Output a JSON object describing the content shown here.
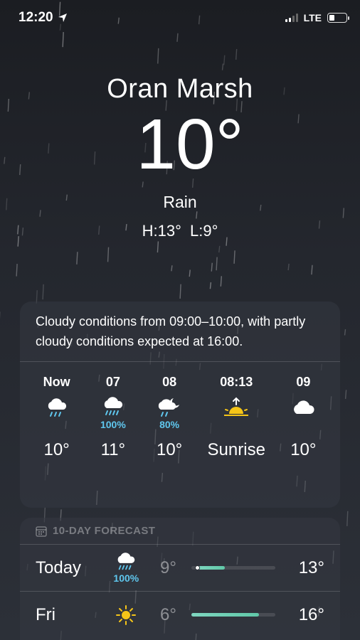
{
  "status": {
    "time": "12:20",
    "network": "LTE",
    "battery_level": 0.3,
    "signal_bars": 2
  },
  "current": {
    "city": "Oran Marsh",
    "temperature": "10°",
    "condition": "Rain",
    "high_low": "H:13°  L:9°"
  },
  "summary": "Cloudy conditions from 09:00–10:00, with partly cloudy conditions expected at 16:00.",
  "hourly": [
    {
      "time": "Now",
      "icon": "rain-cloud-icon",
      "prob": "",
      "value": "10°"
    },
    {
      "time": "07",
      "icon": "rain-cloud-icon",
      "prob": "100%",
      "value": "11°"
    },
    {
      "time": "08",
      "icon": "moon-rain-cloud-icon",
      "prob": "80%",
      "value": "10°"
    },
    {
      "time": "08:13",
      "icon": "sunrise-icon",
      "prob": "",
      "value": "Sunrise"
    },
    {
      "time": "09",
      "icon": "cloud-icon",
      "prob": "",
      "value": "10°"
    }
  ],
  "forecast": {
    "header": "10-DAY FORECAST",
    "days": [
      {
        "day": "Today",
        "icon": "rain-cloud-icon",
        "prob": "100%",
        "low": "9°",
        "high": "13°",
        "range_start": 0.05,
        "range_end": 0.4,
        "current_pos": 0.07
      },
      {
        "day": "Fri",
        "icon": "sun-icon",
        "prob": "",
        "low": "6°",
        "high": "16°",
        "range_start": 0.0,
        "range_end": 0.8,
        "current_pos": null
      }
    ]
  },
  "colors": {
    "accent_blue": "#5fc7ee",
    "bar_green": "#6fd0b4",
    "sun_yellow": "#f5c518"
  }
}
